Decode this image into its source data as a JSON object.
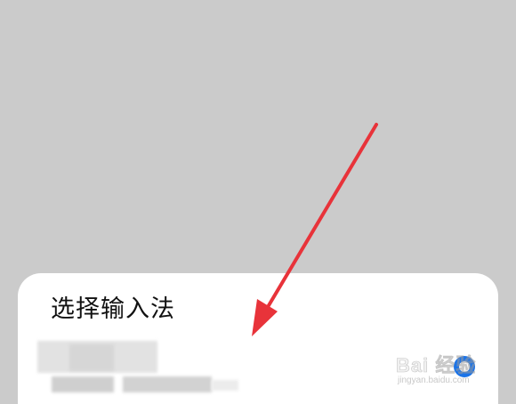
{
  "dialog": {
    "title": "选择输入法"
  },
  "watermark": {
    "logo_text": "Bai 经验",
    "url": "jingyan.baidu.com"
  },
  "colors": {
    "scrim": "#cbcbcb",
    "sheet": "#ffffff",
    "arrow": "#e8333a",
    "radio": "#1a73e8"
  }
}
